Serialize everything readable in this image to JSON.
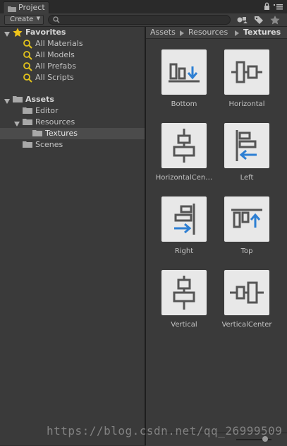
{
  "window": {
    "tab_title": "Project",
    "tab_icon": "project-folder-icon"
  },
  "toolbar": {
    "create_label": "Create",
    "search_value": "",
    "icons": [
      "search-by-type-icon",
      "label-tag-icon",
      "favorite-star-icon"
    ]
  },
  "favorites": {
    "title": "Favorites",
    "items": [
      "All Materials",
      "All Models",
      "All Prefabs",
      "All Scripts"
    ]
  },
  "assets_tree": {
    "root": "Assets",
    "children": [
      {
        "label": "Editor"
      },
      {
        "label": "Resources"
      },
      {
        "label": "Textures"
      },
      {
        "label": "Scenes"
      }
    ]
  },
  "breadcrumb": [
    "Assets",
    "Resources",
    "Textures"
  ],
  "textures": [
    {
      "name": "Bottom",
      "icon": "align-bottom-icon"
    },
    {
      "name": "Horizontal",
      "icon": "align-horizontal-icon"
    },
    {
      "name": "HorizontalCen…",
      "icon": "align-horizontal-center-icon"
    },
    {
      "name": "Left",
      "icon": "align-left-icon"
    },
    {
      "name": "Right",
      "icon": "align-right-icon"
    },
    {
      "name": "Top",
      "icon": "align-top-icon"
    },
    {
      "name": "Vertical",
      "icon": "align-vertical-icon"
    },
    {
      "name": "VerticalCenter",
      "icon": "align-vertical-center-icon"
    }
  ],
  "watermark": "https://blog.csdn.net/qq_26999509",
  "colors": {
    "panel_bg": "#3a3a3a",
    "selection": "#4b4b4b",
    "icon_dark": "#555555",
    "icon_blue": "#2d7fd3",
    "favorite_yellow": "#f0c419"
  }
}
